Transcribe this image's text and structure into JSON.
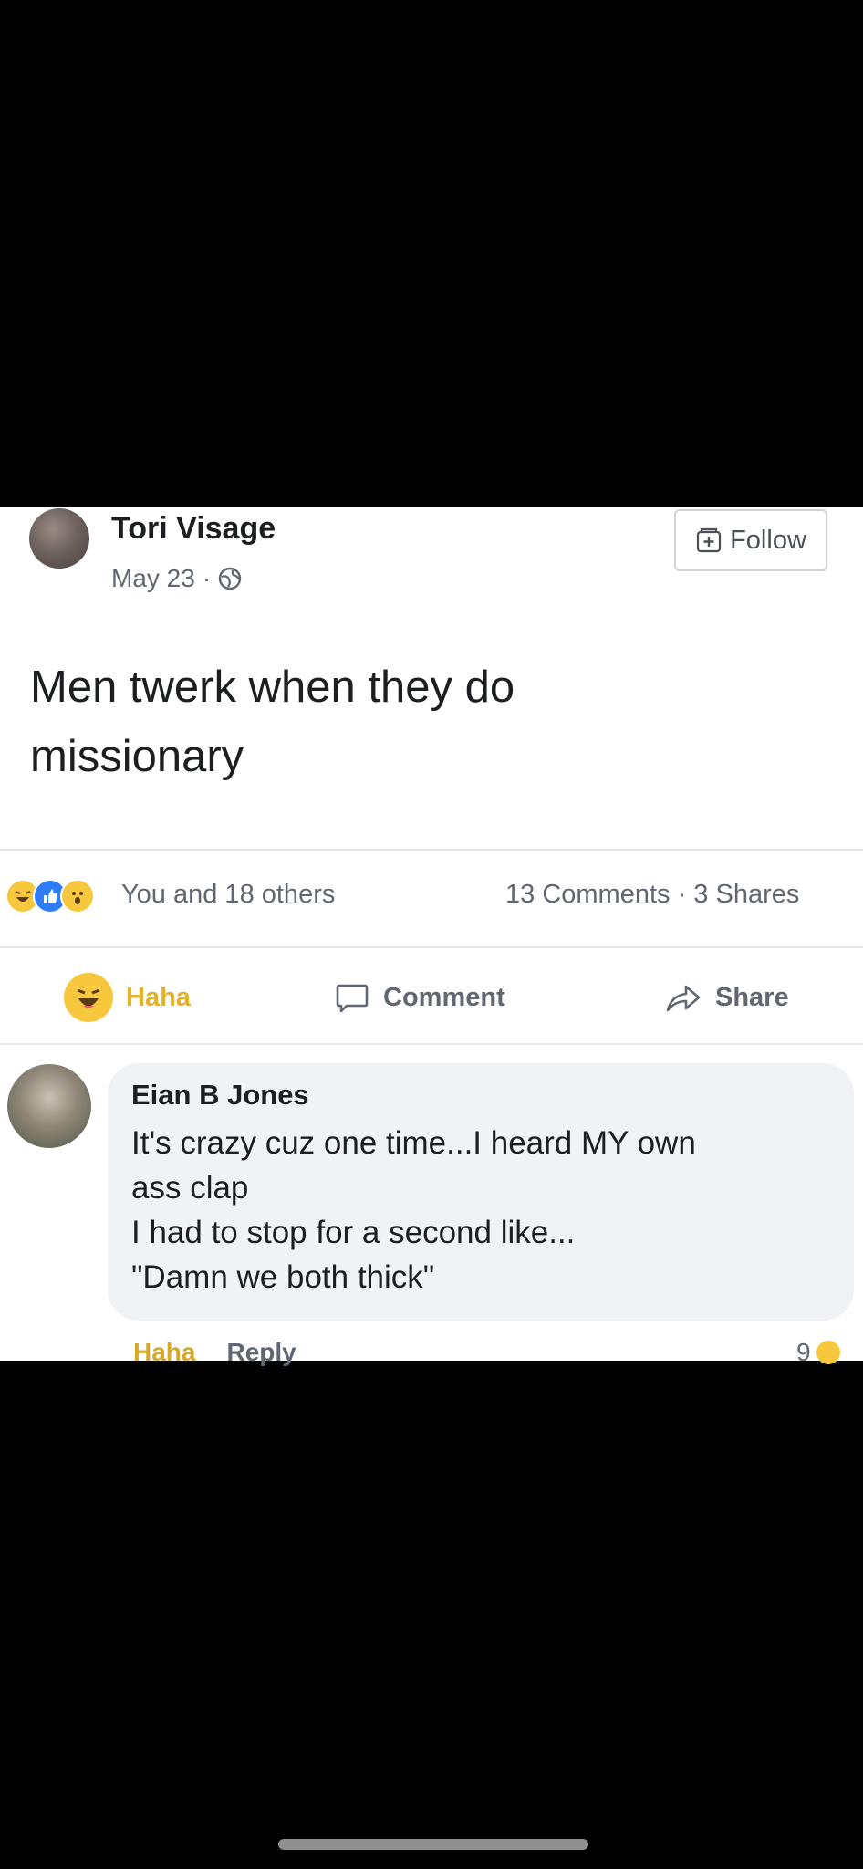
{
  "post": {
    "author": "Tori Visage",
    "date": "May 23",
    "separator": "·",
    "follow_label": "Follow",
    "text_line1": "Men twerk when they do",
    "text_line2": "missionary"
  },
  "summary": {
    "reactions": [
      "haha",
      "like",
      "wow"
    ],
    "reactors": "You and 18 others",
    "counts": "13 Comments · 3 Shares"
  },
  "actions": {
    "haha": "Haha",
    "comment": "Comment",
    "share": "Share"
  },
  "comment": {
    "author": "Eian B Jones",
    "lines": [
      "It's crazy cuz one time...I heard MY own",
      "ass clap",
      "I had to stop for a second like...",
      "\"Damn we both thick\""
    ],
    "haha": "Haha",
    "reply": "Reply",
    "reaction_count": "9"
  },
  "colors": {
    "text": "#1c1e21",
    "meta": "#606770",
    "haha_yellow": "#f7c73d",
    "like_blue": "#2f7df6",
    "bubble": "#f0f2f5"
  },
  "icons": {
    "privacy": "globe-icon",
    "follow": "follow-plus-icon",
    "comment": "comment-bubble-icon",
    "share": "share-arrow-icon"
  }
}
